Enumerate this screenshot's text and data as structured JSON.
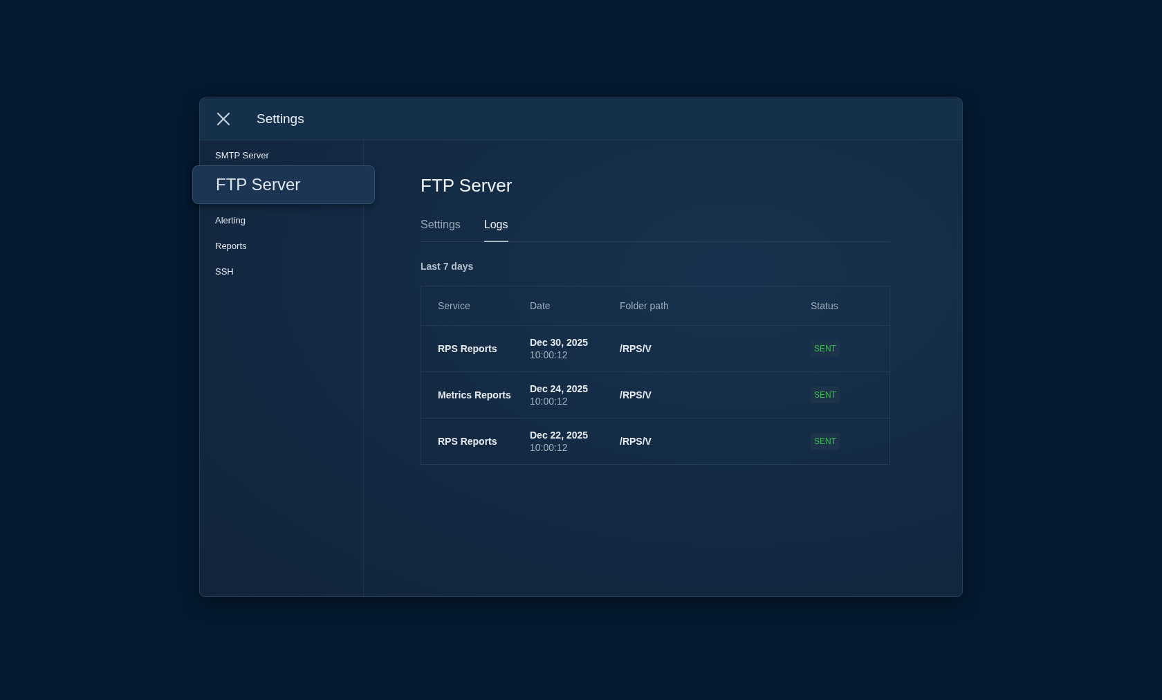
{
  "window": {
    "title": "Settings"
  },
  "sidebar": {
    "items": [
      {
        "label": "SMTP Server",
        "selected": false
      },
      {
        "label": "FTP Server",
        "selected": true
      },
      {
        "label": "Alerting",
        "selected": false
      },
      {
        "label": "Reports",
        "selected": false
      },
      {
        "label": "SSH",
        "selected": false
      }
    ]
  },
  "page": {
    "title": "FTP Server",
    "tabs": [
      {
        "label": "Settings",
        "selected": false
      },
      {
        "label": "Logs",
        "selected": true
      }
    ],
    "range": "Last 7 days",
    "table": {
      "columns": [
        "Service",
        "Date",
        "Folder path",
        "Status"
      ],
      "rows": [
        {
          "service": "RPS Reports",
          "date": "Dec 30, 2025",
          "time": "10:00:12",
          "path": "/RPS/V",
          "status": "SENT"
        },
        {
          "service": "Metrics Reports",
          "date": "Dec 24, 2025",
          "time": "10:00:12",
          "path": "/RPS/V",
          "status": "SENT"
        },
        {
          "service": "RPS Reports",
          "date": "Dec 22, 2025",
          "time": "10:00:12",
          "path": "/RPS/V",
          "status": "SENT"
        }
      ]
    }
  }
}
